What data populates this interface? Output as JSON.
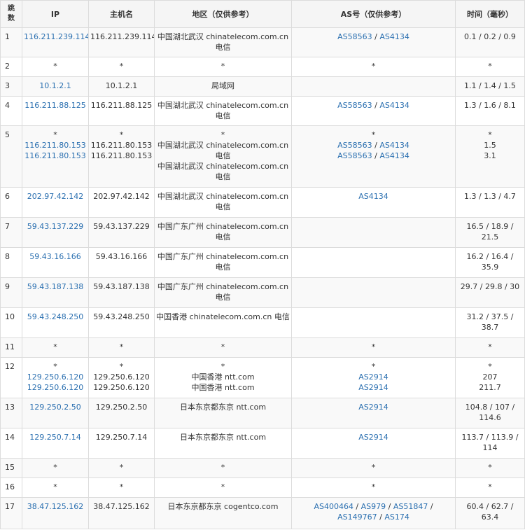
{
  "headers": {
    "hop": "跳数",
    "ip": "IP",
    "host": "主机名",
    "region": "地区（仅供参考）",
    "as": "AS号（仅供参考）",
    "time": "时间（毫秒）"
  },
  "colors": {
    "link": "#2a6fb0",
    "header_bg": "#f5f5f5",
    "border": "#dcdcdc"
  },
  "rows": [
    {
      "hop": "1",
      "ip": [
        "116.211.239.114"
      ],
      "host": [
        "116.211.239.114"
      ],
      "region": [
        "中国湖北武汉 chinatelecom.com.cn 电信"
      ],
      "as": [
        [
          "AS58563",
          "AS4134"
        ]
      ],
      "time": [
        "0.1 / 0.2 / 0.9"
      ]
    },
    {
      "hop": "2",
      "ip": [
        "*"
      ],
      "host": [
        "*"
      ],
      "region": [
        "*"
      ],
      "as": [
        [
          "*"
        ]
      ],
      "time": [
        "*"
      ]
    },
    {
      "hop": "3",
      "ip": [
        "10.1.2.1"
      ],
      "host": [
        "10.1.2.1"
      ],
      "region": [
        "局域网"
      ],
      "as": [
        []
      ],
      "time": [
        "1.1 / 1.4 / 1.5"
      ]
    },
    {
      "hop": "4",
      "ip": [
        "116.211.88.125"
      ],
      "host": [
        "116.211.88.125"
      ],
      "region": [
        "中国湖北武汉 chinatelecom.com.cn 电信"
      ],
      "as": [
        [
          "AS58563",
          "AS4134"
        ]
      ],
      "time": [
        "1.3 / 1.6 / 8.1"
      ]
    },
    {
      "hop": "5",
      "ip": [
        "*",
        "116.211.80.153",
        "116.211.80.153"
      ],
      "host": [
        "*",
        "116.211.80.153",
        "116.211.80.153"
      ],
      "region": [
        "*",
        "中国湖北武汉 chinatelecom.com.cn 电信",
        "中国湖北武汉 chinatelecom.com.cn 电信"
      ],
      "as": [
        [
          "*"
        ],
        [
          "AS58563",
          "AS4134"
        ],
        [
          "AS58563",
          "AS4134"
        ]
      ],
      "time": [
        "*",
        "1.5",
        "3.1"
      ]
    },
    {
      "hop": "6",
      "ip": [
        "202.97.42.142"
      ],
      "host": [
        "202.97.42.142"
      ],
      "region": [
        "中国湖北武汉 chinatelecom.com.cn 电信"
      ],
      "as": [
        [
          "AS4134"
        ]
      ],
      "time": [
        "1.3 / 1.3 / 4.7"
      ]
    },
    {
      "hop": "7",
      "ip": [
        "59.43.137.229"
      ],
      "host": [
        "59.43.137.229"
      ],
      "region": [
        "中国广东广州 chinatelecom.com.cn 电信"
      ],
      "as": [
        []
      ],
      "time": [
        "16.5 / 18.9 / 21.5"
      ]
    },
    {
      "hop": "8",
      "ip": [
        "59.43.16.166"
      ],
      "host": [
        "59.43.16.166"
      ],
      "region": [
        "中国广东广州 chinatelecom.com.cn 电信"
      ],
      "as": [
        []
      ],
      "time": [
        "16.2 / 16.4 / 35.9"
      ]
    },
    {
      "hop": "9",
      "ip": [
        "59.43.187.138"
      ],
      "host": [
        "59.43.187.138"
      ],
      "region": [
        "中国广东广州 chinatelecom.com.cn 电信"
      ],
      "as": [
        []
      ],
      "time": [
        "29.7 / 29.8 / 30"
      ]
    },
    {
      "hop": "10",
      "ip": [
        "59.43.248.250"
      ],
      "host": [
        "59.43.248.250"
      ],
      "region": [
        "中国香港 chinatelecom.com.cn 电信"
      ],
      "as": [
        []
      ],
      "time": [
        "31.2 / 37.5 / 38.7"
      ]
    },
    {
      "hop": "11",
      "ip": [
        "*"
      ],
      "host": [
        "*"
      ],
      "region": [
        "*"
      ],
      "as": [
        [
          "*"
        ]
      ],
      "time": [
        "*"
      ]
    },
    {
      "hop": "12",
      "ip": [
        "*",
        "129.250.6.120",
        "129.250.6.120"
      ],
      "host": [
        "*",
        "129.250.6.120",
        "129.250.6.120"
      ],
      "region": [
        "*",
        "中国香港 ntt.com",
        "中国香港 ntt.com"
      ],
      "as": [
        [
          "*"
        ],
        [
          "AS2914"
        ],
        [
          "AS2914"
        ]
      ],
      "time": [
        "*",
        "207",
        "211.7"
      ]
    },
    {
      "hop": "13",
      "ip": [
        "129.250.2.50"
      ],
      "host": [
        "129.250.2.50"
      ],
      "region": [
        "日本东京都东京 ntt.com"
      ],
      "as": [
        [
          "AS2914"
        ]
      ],
      "time": [
        "104.8 / 107 / 114.6"
      ]
    },
    {
      "hop": "14",
      "ip": [
        "129.250.7.14"
      ],
      "host": [
        "129.250.7.14"
      ],
      "region": [
        "日本东京都东京 ntt.com"
      ],
      "as": [
        [
          "AS2914"
        ]
      ],
      "time": [
        "113.7 / 113.9 / 114"
      ]
    },
    {
      "hop": "15",
      "ip": [
        "*"
      ],
      "host": [
        "*"
      ],
      "region": [
        "*"
      ],
      "as": [
        [
          "*"
        ]
      ],
      "time": [
        "*"
      ]
    },
    {
      "hop": "16",
      "ip": [
        "*"
      ],
      "host": [
        "*"
      ],
      "region": [
        "*"
      ],
      "as": [
        [
          "*"
        ]
      ],
      "time": [
        "*"
      ]
    },
    {
      "hop": "17",
      "ip": [
        "38.47.125.162"
      ],
      "host": [
        "38.47.125.162"
      ],
      "region": [
        "日本东京都东京 cogentco.com"
      ],
      "as": [
        [
          "AS400464",
          "AS979",
          "AS51847",
          "AS149767",
          "AS174"
        ]
      ],
      "time": [
        "60.4 / 62.7 / 63.4"
      ]
    }
  ]
}
